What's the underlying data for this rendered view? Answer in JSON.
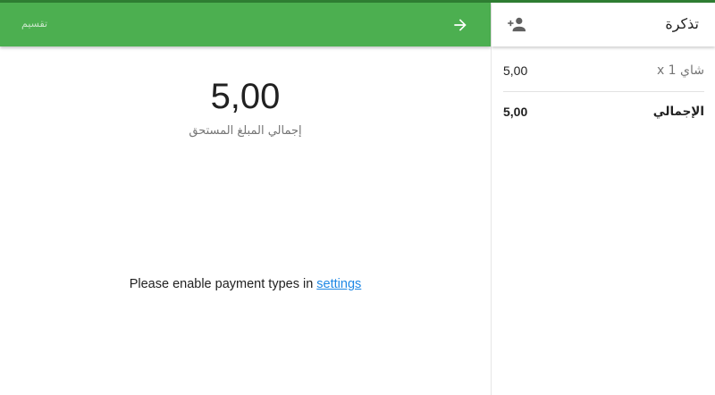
{
  "left_appbar": {
    "split_label": "تقسيم",
    "next_icon": "arrow-right-icon",
    "color": "#4caf50"
  },
  "payment": {
    "amount": "5,00",
    "caption": "إجمالي المبلغ المستحق",
    "message_prefix": "Please enable payment types in ",
    "settings_link": "settings",
    "link_color": "#1e88e5"
  },
  "ticket": {
    "title": "تذكرة",
    "add_customer_icon": "add-person-icon",
    "items": [
      {
        "name": "شاي x 1",
        "price": "5,00"
      }
    ],
    "total_label": "الإجمالي",
    "total_price": "5,00"
  }
}
